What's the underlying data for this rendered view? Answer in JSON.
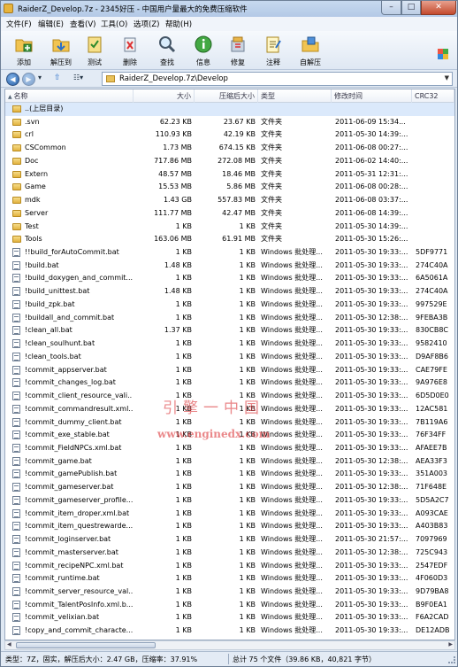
{
  "title": "RaiderZ_Develop.7z - 2345好压 - 中国用户量最大的免费压缩软件",
  "window_controls": {
    "minimize": "–",
    "maximize": "□",
    "close": "✕"
  },
  "menu": [
    "文件(F)",
    "编辑(E)",
    "查看(V)",
    "工具(O)",
    "选项(Z)",
    "帮助(H)"
  ],
  "toolbar": [
    {
      "label": "添加",
      "icon": "add-icon"
    },
    {
      "label": "解压到",
      "icon": "extract-to-icon"
    },
    {
      "label": "测试",
      "icon": "test-icon"
    },
    {
      "label": "删除",
      "icon": "delete-icon"
    },
    {
      "label": "查找",
      "icon": "search-icon"
    },
    {
      "label": "信息",
      "icon": "info-icon"
    },
    {
      "label": "修复",
      "icon": "repair-icon"
    },
    {
      "label": "注释",
      "icon": "comment-icon"
    },
    {
      "label": "自解压",
      "icon": "sfx-icon"
    }
  ],
  "address": {
    "path": "RaiderZ_Develop.7z\\Develop"
  },
  "columns": [
    "名称",
    "大小",
    "压缩后大小",
    "类型",
    "修改时间",
    "CRC32"
  ],
  "up_row": "..(上层目录)",
  "rows": [
    {
      "name": ".svn",
      "size": "62.23 KB",
      "packed": "23.67 KB",
      "type": "文件夹",
      "modified": "2011-06-09 15:34...",
      "crc": "",
      "kind": "folder"
    },
    {
      "name": "crl",
      "size": "110.93 KB",
      "packed": "42.19 KB",
      "type": "文件夹",
      "modified": "2011-05-30 14:39:...",
      "crc": "",
      "kind": "folder"
    },
    {
      "name": "CSCommon",
      "size": "1.73 MB",
      "packed": "674.15 KB",
      "type": "文件夹",
      "modified": "2011-06-08 00:27:...",
      "crc": "",
      "kind": "folder"
    },
    {
      "name": "Doc",
      "size": "717.86 MB",
      "packed": "272.08 MB",
      "type": "文件夹",
      "modified": "2011-06-02 14:40:...",
      "crc": "",
      "kind": "folder"
    },
    {
      "name": "Extern",
      "size": "48.57 MB",
      "packed": "18.46 MB",
      "type": "文件夹",
      "modified": "2011-05-31 12:31:...",
      "crc": "",
      "kind": "folder"
    },
    {
      "name": "Game",
      "size": "15.53 MB",
      "packed": "5.86 MB",
      "type": "文件夹",
      "modified": "2011-06-08 00:28:...",
      "crc": "",
      "kind": "folder"
    },
    {
      "name": "mdk",
      "size": "1.43 GB",
      "packed": "557.83 MB",
      "type": "文件夹",
      "modified": "2011-06-08 03:37:...",
      "crc": "",
      "kind": "folder"
    },
    {
      "name": "Server",
      "size": "111.77 MB",
      "packed": "42.47 MB",
      "type": "文件夹",
      "modified": "2011-06-08 14:39:...",
      "crc": "",
      "kind": "folder"
    },
    {
      "name": "Test",
      "size": "1 KB",
      "packed": "1 KB",
      "type": "文件夹",
      "modified": "2011-05-30 14:39:...",
      "crc": "",
      "kind": "folder"
    },
    {
      "name": "Tools",
      "size": "163.06 MB",
      "packed": "61.91 MB",
      "type": "文件夹",
      "modified": "2011-05-30 15:26:...",
      "crc": "",
      "kind": "folder"
    },
    {
      "name": "!!build_forAutoCommit.bat",
      "size": "1 KB",
      "packed": "1 KB",
      "type": "Windows 批处理...",
      "modified": "2011-05-30 19:33:...",
      "crc": "5DF9771",
      "kind": "bat"
    },
    {
      "name": "!build.bat",
      "size": "1.48 KB",
      "packed": "1 KB",
      "type": "Windows 批处理...",
      "modified": "2011-05-30 19:33:...",
      "crc": "274C40A",
      "kind": "bat"
    },
    {
      "name": "!build_doxygen_and_commit...",
      "size": "1 KB",
      "packed": "1 KB",
      "type": "Windows 批处理...",
      "modified": "2011-05-30 19:33:...",
      "crc": "6A5061A",
      "kind": "bat"
    },
    {
      "name": "!build_unittest.bat",
      "size": "1.48 KB",
      "packed": "1 KB",
      "type": "Windows 批处理...",
      "modified": "2011-05-30 19:33:...",
      "crc": "274C40A",
      "kind": "bat"
    },
    {
      "name": "!build_zpk.bat",
      "size": "1 KB",
      "packed": "1 KB",
      "type": "Windows 批处理...",
      "modified": "2011-05-30 19:33:...",
      "crc": "997529E",
      "kind": "bat"
    },
    {
      "name": "!buildall_and_commit.bat",
      "size": "1 KB",
      "packed": "1 KB",
      "type": "Windows 批处理...",
      "modified": "2011-05-30 12:38:...",
      "crc": "9FEBA3B",
      "kind": "bat"
    },
    {
      "name": "!clean_all.bat",
      "size": "1.37 KB",
      "packed": "1 KB",
      "type": "Windows 批处理...",
      "modified": "2011-05-30 19:33:...",
      "crc": "830CB8C",
      "kind": "bat"
    },
    {
      "name": "!clean_soulhunt.bat",
      "size": "1 KB",
      "packed": "1 KB",
      "type": "Windows 批处理...",
      "modified": "2011-05-30 19:33:...",
      "crc": "9582410",
      "kind": "bat"
    },
    {
      "name": "!clean_tools.bat",
      "size": "1 KB",
      "packed": "1 KB",
      "type": "Windows 批处理...",
      "modified": "2011-05-30 19:33:...",
      "crc": "D9AF8B6",
      "kind": "bat"
    },
    {
      "name": "!commit_appserver.bat",
      "size": "1 KB",
      "packed": "1 KB",
      "type": "Windows 批处理...",
      "modified": "2011-05-30 19:33:...",
      "crc": "CAE79FE",
      "kind": "bat"
    },
    {
      "name": "!commit_changes_log.bat",
      "size": "1 KB",
      "packed": "1 KB",
      "type": "Windows 批处理...",
      "modified": "2011-05-30 19:33:...",
      "crc": "9A976E8",
      "kind": "bat"
    },
    {
      "name": "!commit_client_resource_vali...",
      "size": "1 KB",
      "packed": "1 KB",
      "type": "Windows 批处理...",
      "modified": "2011-05-30 19:33:...",
      "crc": "6D5D0E0",
      "kind": "bat"
    },
    {
      "name": "!commit_commandresult.xml...",
      "size": "1 KB",
      "packed": "1 KB",
      "type": "Windows 批处理...",
      "modified": "2011-05-30 19:33:...",
      "crc": "12AC581",
      "kind": "bat"
    },
    {
      "name": "!commit_dummy_client.bat",
      "size": "1 KB",
      "packed": "1 KB",
      "type": "Windows 批处理...",
      "modified": "2011-05-30 19:33:...",
      "crc": "7B119A6",
      "kind": "bat"
    },
    {
      "name": "!commit_exe_stable.bat",
      "size": "1 KB",
      "packed": "1 KB",
      "type": "Windows 批处理...",
      "modified": "2011-05-30 19:33:...",
      "crc": "76F34FF",
      "kind": "bat"
    },
    {
      "name": "!commit_FieldNPCs.xml.bat",
      "size": "1 KB",
      "packed": "1 KB",
      "type": "Windows 批处理...",
      "modified": "2011-05-30 19:33:...",
      "crc": "AFAEE7B",
      "kind": "bat"
    },
    {
      "name": "!commit_game.bat",
      "size": "1 KB",
      "packed": "1 KB",
      "type": "Windows 批处理...",
      "modified": "2011-05-30 12:38:...",
      "crc": "AEA33F3",
      "kind": "bat"
    },
    {
      "name": "!commit_gamePublish.bat",
      "size": "1 KB",
      "packed": "1 KB",
      "type": "Windows 批处理...",
      "modified": "2011-05-30 19:33:...",
      "crc": "351A003",
      "kind": "bat"
    },
    {
      "name": "!commit_gameserver.bat",
      "size": "1 KB",
      "packed": "1 KB",
      "type": "Windows 批处理...",
      "modified": "2011-05-30 12:38:...",
      "crc": "71F648E",
      "kind": "bat"
    },
    {
      "name": "!commit_gameserver_profile...",
      "size": "1 KB",
      "packed": "1 KB",
      "type": "Windows 批处理...",
      "modified": "2011-05-30 19:33:...",
      "crc": "5D5A2C7",
      "kind": "bat"
    },
    {
      "name": "!commit_item_droper.xml.bat",
      "size": "1 KB",
      "packed": "1 KB",
      "type": "Windows 批处理...",
      "modified": "2011-05-30 19:33:...",
      "crc": "A093CAE",
      "kind": "bat"
    },
    {
      "name": "!commit_item_questrewarde...",
      "size": "1 KB",
      "packed": "1 KB",
      "type": "Windows 批处理...",
      "modified": "2011-05-30 19:33:...",
      "crc": "A403B83",
      "kind": "bat"
    },
    {
      "name": "!commit_loginserver.bat",
      "size": "1 KB",
      "packed": "1 KB",
      "type": "Windows 批处理...",
      "modified": "2011-05-30 21:57:...",
      "crc": "7097969",
      "kind": "bat"
    },
    {
      "name": "!commit_masterserver.bat",
      "size": "1 KB",
      "packed": "1 KB",
      "type": "Windows 批处理...",
      "modified": "2011-05-30 12:38:...",
      "crc": "725C943",
      "kind": "bat"
    },
    {
      "name": "!commit_recipeNPC.xml.bat",
      "size": "1 KB",
      "packed": "1 KB",
      "type": "Windows 批处理...",
      "modified": "2011-05-30 19:33:...",
      "crc": "2547EDF",
      "kind": "bat"
    },
    {
      "name": "!commit_runtime.bat",
      "size": "1 KB",
      "packed": "1 KB",
      "type": "Windows 批处理...",
      "modified": "2011-05-30 19:33:...",
      "crc": "4F060D3",
      "kind": "bat"
    },
    {
      "name": "!commit_server_resource_val...",
      "size": "1 KB",
      "packed": "1 KB",
      "type": "Windows 批处理...",
      "modified": "2011-05-30 19:33:...",
      "crc": "9D79BA8",
      "kind": "bat"
    },
    {
      "name": "!commit_TalentPosInfo.xml.b...",
      "size": "1 KB",
      "packed": "1 KB",
      "type": "Windows 批处理...",
      "modified": "2011-05-30 19:33:...",
      "crc": "B9F0EA1",
      "kind": "bat"
    },
    {
      "name": "!commit_velixian.bat",
      "size": "1 KB",
      "packed": "1 KB",
      "type": "Windows 批处理...",
      "modified": "2011-05-30 19:33:...",
      "crc": "F6A2CAD",
      "kind": "bat"
    },
    {
      "name": "!copy_and_commit_characte...",
      "size": "1 KB",
      "packed": "1 KB",
      "type": "Windows 批处理...",
      "modified": "2011-05-30 19:33:...",
      "crc": "DE12ADB",
      "kind": "bat"
    }
  ],
  "watermark": {
    "line1": "引擎一中国",
    "line2": "www.enginedx.com"
  },
  "status": {
    "left": "类型：7Z，固实，解压后大小：2.47 GB，压缩率：37.91%",
    "right": "总计 75 个文件（39.86 KB，40,821 字节）"
  }
}
